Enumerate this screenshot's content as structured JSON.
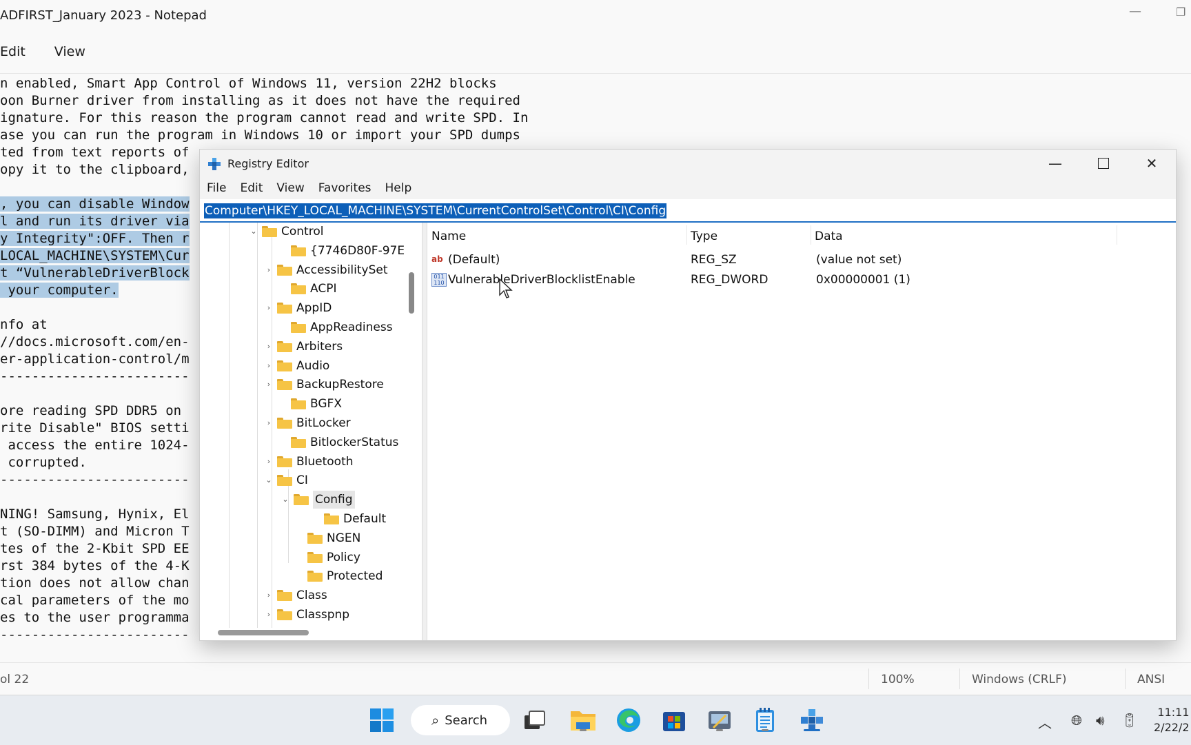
{
  "notepad": {
    "title": "ADFIRST_January 2023 - Notepad",
    "menu": [
      "Edit",
      "View"
    ],
    "lines": [
      {
        "text": "n enabled, Smart App Control of Windows 11, version 22H2 blocks",
        "sel": false
      },
      {
        "text": "oon Burner driver from installing as it does not have the required",
        "sel": false
      },
      {
        "text": "ignature. For this reason the program cannot read and write SPD. In",
        "sel": false
      },
      {
        "text": "ase you can run the program in Windows 10 or import your SPD dumps",
        "sel": false
      },
      {
        "text": "ted from text reports of",
        "sel": false
      },
      {
        "text": "opy it to the clipboard,",
        "sel": false
      },
      {
        "text": "",
        "sel": false
      },
      {
        "text": ", you can disable Window",
        "sel": true
      },
      {
        "text": "l and run its driver via",
        "sel": true
      },
      {
        "text": "y Integrity\":OFF. Then r",
        "sel": true
      },
      {
        "text": "LOCAL_MACHINE\\SYSTEM\\Cur",
        "sel": true
      },
      {
        "text": "t “VulnerableDriverBlock",
        "sel": true
      },
      {
        "text": " your computer.",
        "sel": true
      },
      {
        "text": "",
        "sel": false
      },
      {
        "text": "nfo at",
        "sel": false
      },
      {
        "text": "//docs.microsoft.com/en-",
        "sel": false
      },
      {
        "text": "er-application-control/m",
        "sel": false
      },
      {
        "text": "------------------------",
        "sel": false
      },
      {
        "text": "",
        "sel": false
      },
      {
        "text": "ore reading SPD DDR5 on",
        "sel": false
      },
      {
        "text": "rite Disable\" BIOS setti",
        "sel": false
      },
      {
        "text": " access the entire 1024-",
        "sel": false
      },
      {
        "text": " corrupted.",
        "sel": false
      },
      {
        "text": "------------------------",
        "sel": false
      },
      {
        "text": "",
        "sel": false
      },
      {
        "text": "NING! Samsung, Hynix, El",
        "sel": false
      },
      {
        "text": "t (SO-DIMM) and Micron T",
        "sel": false
      },
      {
        "text": "tes of the 2-Kbit SPD EE",
        "sel": false
      },
      {
        "text": "rst 384 bytes of the 4-K",
        "sel": false
      },
      {
        "text": "tion does not allow chan",
        "sel": false
      },
      {
        "text": "cal parameters of the mo",
        "sel": false
      },
      {
        "text": "es to the user programma",
        "sel": false
      },
      {
        "text": "------------------------",
        "sel": false
      }
    ],
    "status": {
      "pos": "ol 22",
      "zoom": "100%",
      "eol": "Windows (CRLF)",
      "enc": "ANSI"
    }
  },
  "registry": {
    "title": "Registry Editor",
    "menu": [
      "File",
      "Edit",
      "View",
      "Favorites",
      "Help"
    ],
    "address": "Computer\\HKEY_LOCAL_MACHINE\\SYSTEM\\CurrentControlSet\\Control\\CI\\Config",
    "tree": [
      {
        "label": "Control",
        "expander": "down"
      },
      {
        "label": "{7746D80F-97E",
        "expander": "none"
      },
      {
        "label": "AccessibilitySet",
        "expander": "right"
      },
      {
        "label": "ACPI",
        "expander": "none"
      },
      {
        "label": "AppID",
        "expander": "right"
      },
      {
        "label": "AppReadiness",
        "expander": "none"
      },
      {
        "label": "Arbiters",
        "expander": "right"
      },
      {
        "label": "Audio",
        "expander": "right"
      },
      {
        "label": "BackupRestore",
        "expander": "right"
      },
      {
        "label": "BGFX",
        "expander": "none"
      },
      {
        "label": "BitLocker",
        "expander": "right"
      },
      {
        "label": "BitlockerStatus",
        "expander": "none"
      },
      {
        "label": "Bluetooth",
        "expander": "right"
      },
      {
        "label": "CI",
        "expander": "down"
      },
      {
        "label": "Config",
        "expander": "down"
      },
      {
        "label": "Default",
        "expander": "none"
      },
      {
        "label": "NGEN",
        "expander": "none"
      },
      {
        "label": "Policy",
        "expander": "none"
      },
      {
        "label": "Protected",
        "expander": "none"
      },
      {
        "label": "Class",
        "expander": "right"
      },
      {
        "label": "Classpnp",
        "expander": "right"
      }
    ],
    "columns": [
      "Name",
      "Type",
      "Data"
    ],
    "values": [
      {
        "name": "(Default)",
        "type": "REG_SZ",
        "data": "(value not set)",
        "icon": "string-value-icon"
      },
      {
        "name": "VulnerableDriverBlocklistEnable",
        "type": "REG_DWORD",
        "data": "0x00000001 (1)",
        "icon": "dword-value-icon"
      }
    ]
  },
  "taskbar": {
    "search_label": "Search",
    "time": "11:11",
    "date": "2/22/2"
  }
}
